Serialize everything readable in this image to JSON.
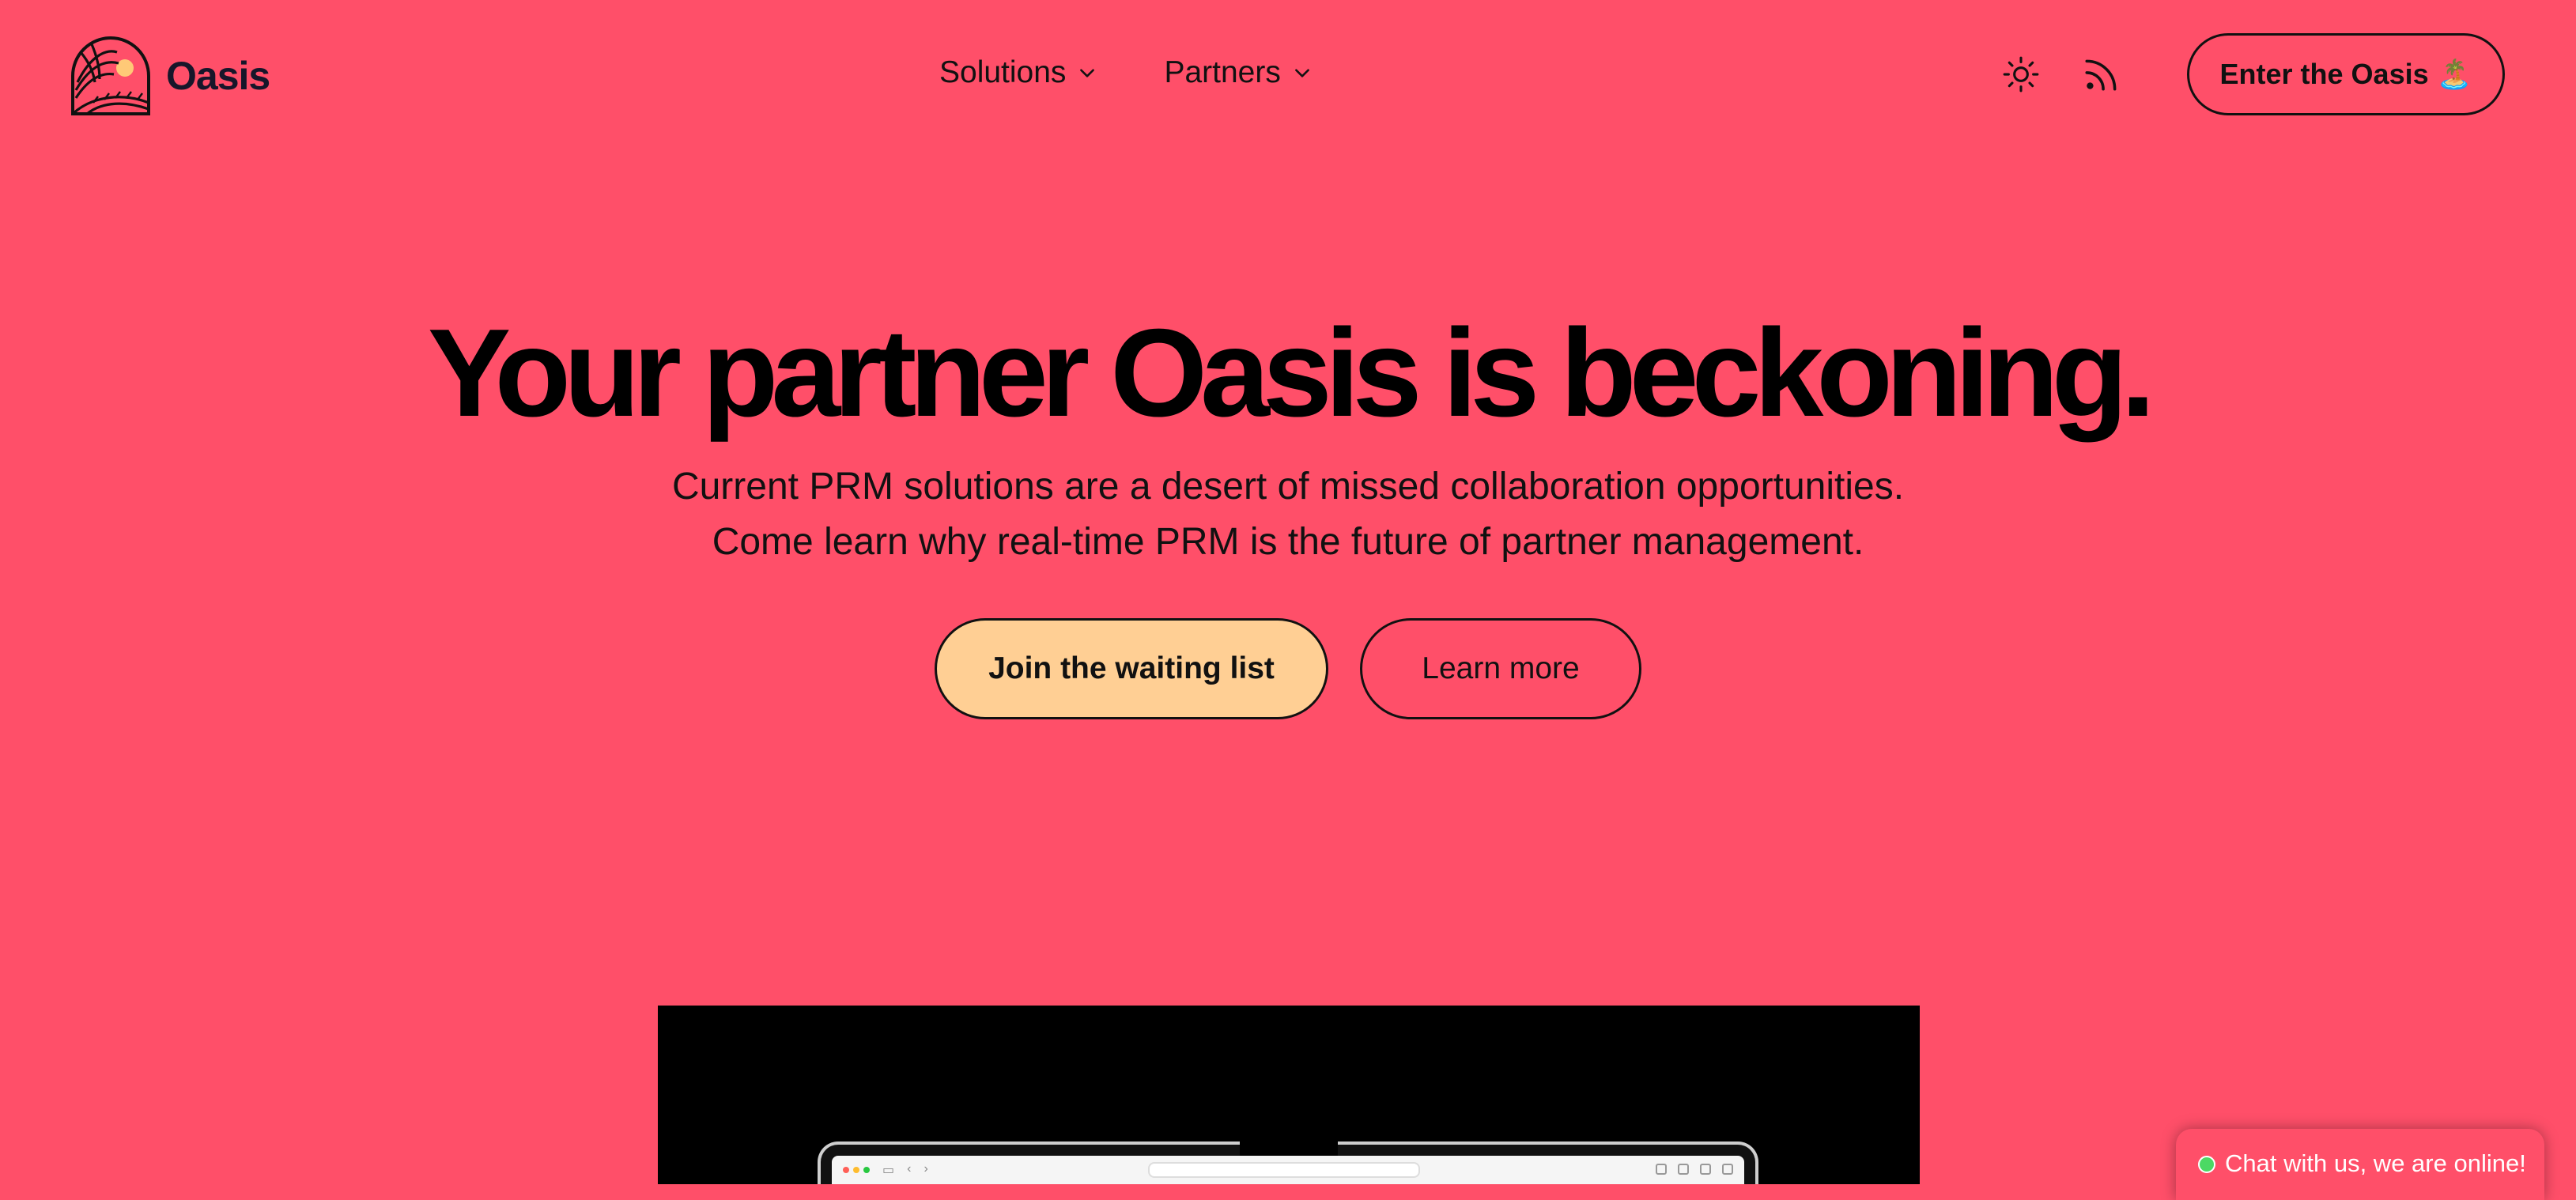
{
  "header": {
    "brand_name": "Oasis",
    "nav": [
      {
        "label": "Solutions"
      },
      {
        "label": "Partners"
      }
    ],
    "cta_label": "Enter the Oasis",
    "cta_emoji": "🏝️"
  },
  "hero": {
    "title": "Your partner Oasis is beckoning.",
    "subtitle_line1": "Current PRM solutions are a desert of missed collaboration opportunities.",
    "subtitle_line2": "Come learn why real-time PRM is the future of partner management.",
    "primary_button": "Join the waiting list",
    "secondary_button": "Learn more"
  },
  "chat_widget": {
    "label": "Chat with us, we are online!",
    "status_color": "#4CD964"
  },
  "colors": {
    "background": "#FF4F69",
    "primary_button": "#FFCF94",
    "text": "#111111",
    "logo_sun": "#FFC977"
  },
  "icons": {
    "logo": "oasis-sunset-logo",
    "theme_toggle": "sun-icon",
    "feed": "rss-icon",
    "nav_chevron": "chevron-down-icon"
  }
}
